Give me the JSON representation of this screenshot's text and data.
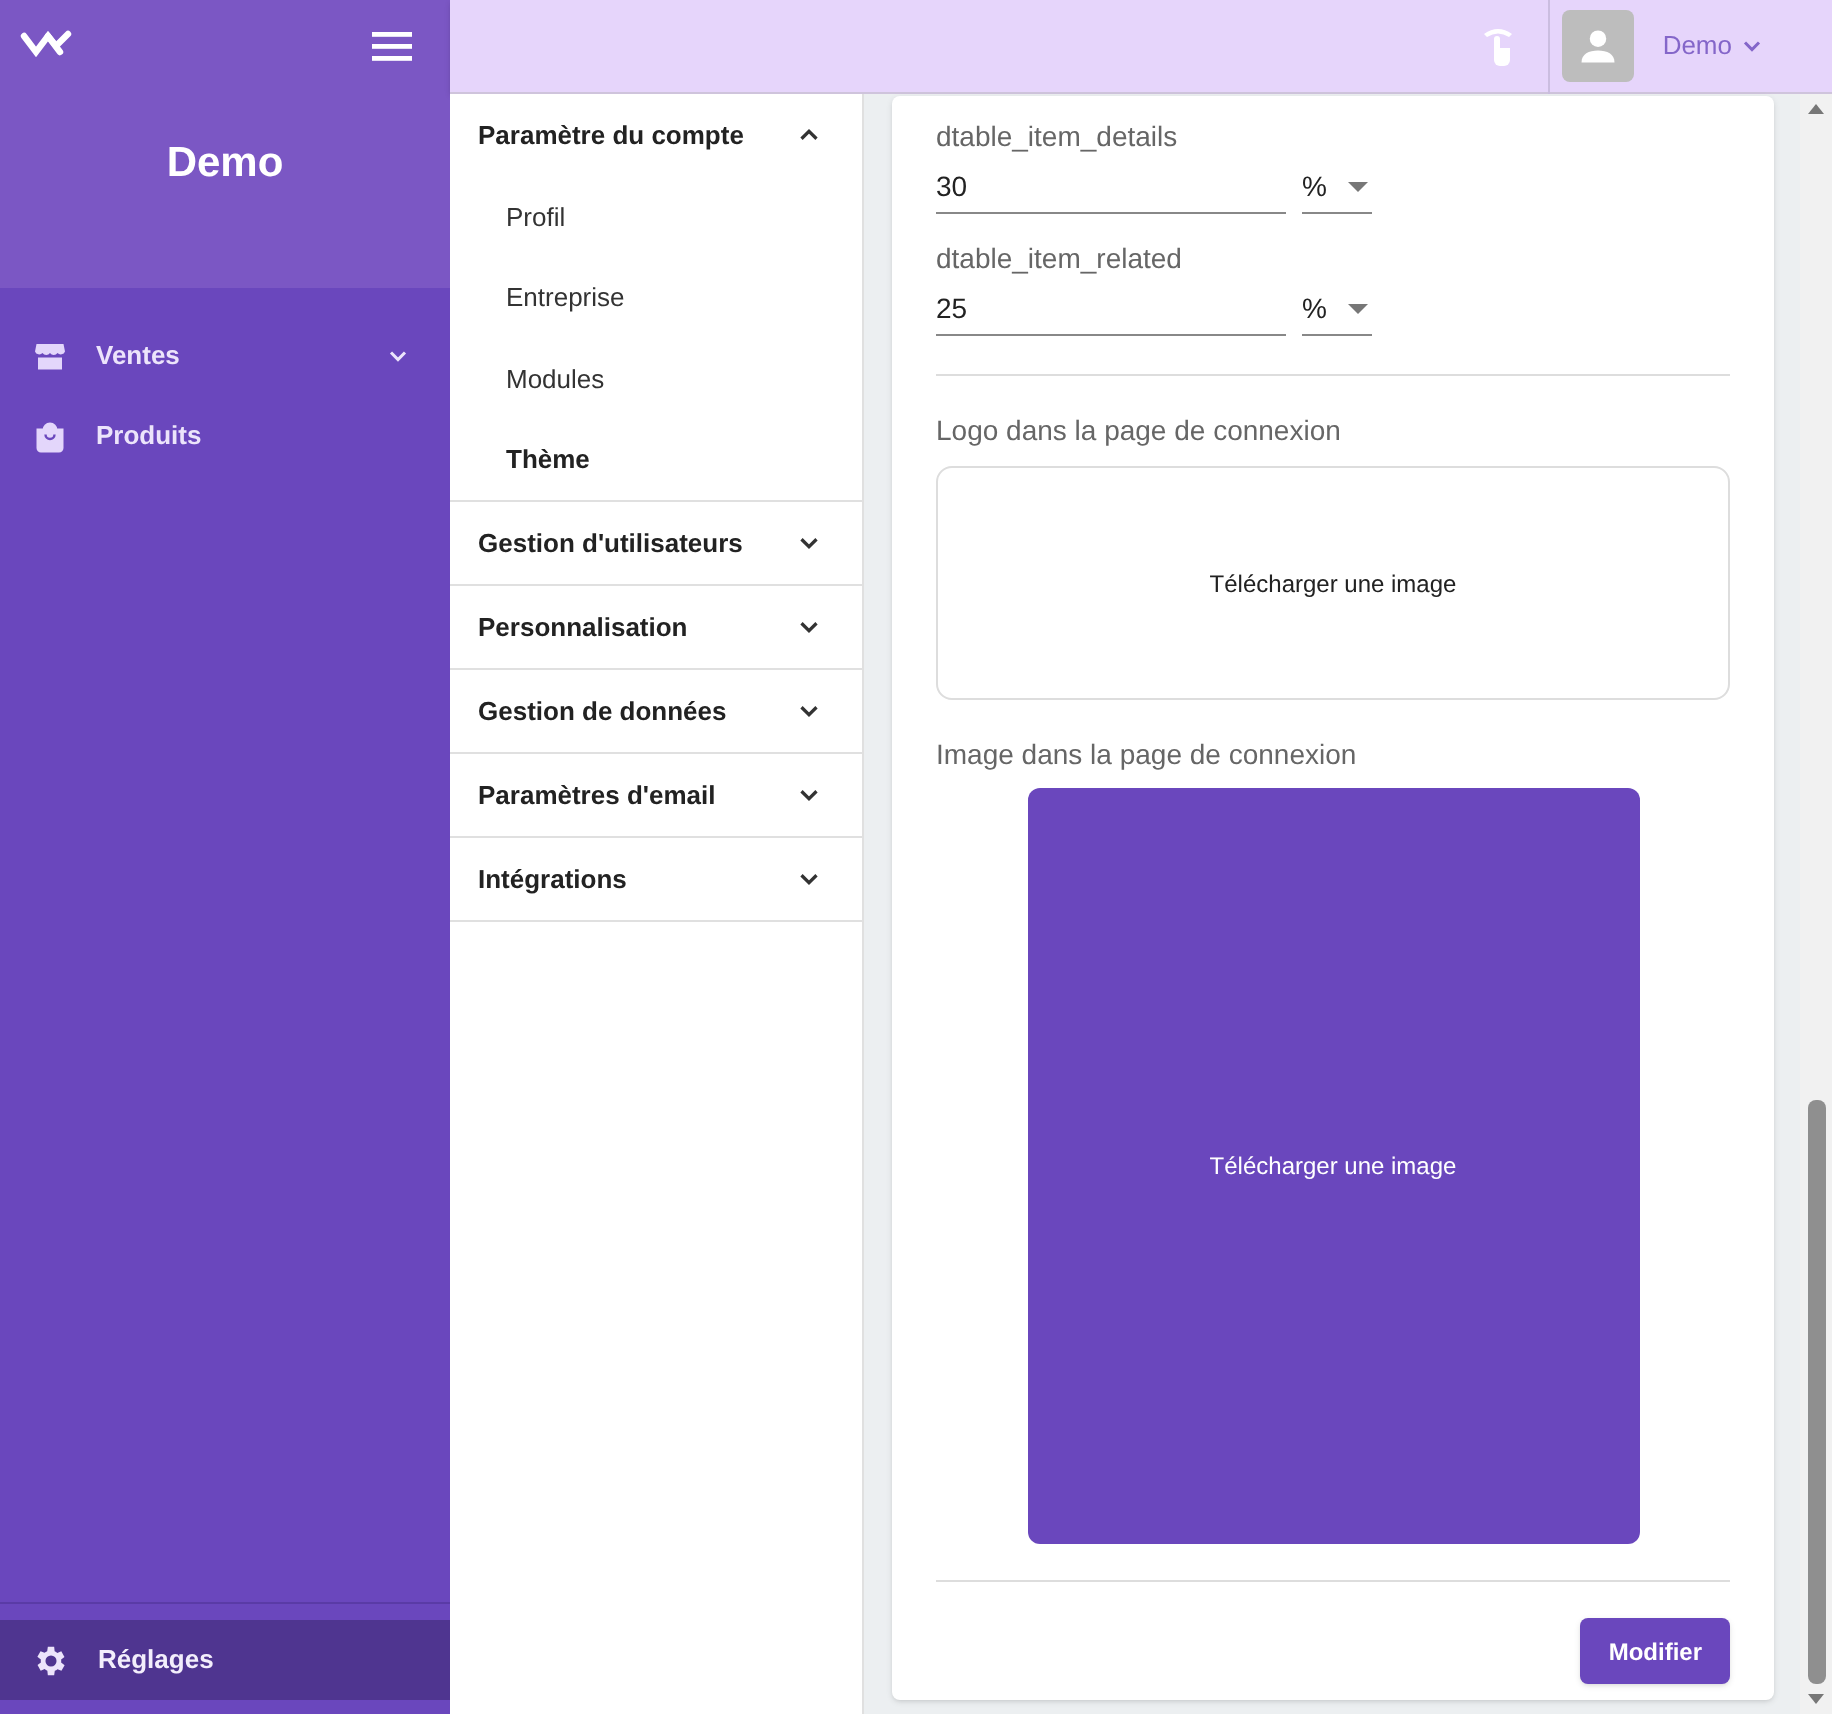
{
  "sidebar": {
    "title": "Demo",
    "nav": [
      {
        "label": "Ventes",
        "kind": "store",
        "expandable": true,
        "selected": false
      },
      {
        "label": "Produits",
        "kind": "bag",
        "expandable": false,
        "selected": false
      }
    ],
    "footer_item": {
      "label": "Réglages",
      "selected": true
    }
  },
  "topbar": {
    "user": "Demo"
  },
  "settings_menu": [
    {
      "label": "Paramètre du compte",
      "expanded": true,
      "children": [
        {
          "label": "Profil",
          "selected": false
        },
        {
          "label": "Entreprise",
          "selected": false
        },
        {
          "label": "Modules",
          "selected": false
        },
        {
          "label": "Thème",
          "selected": true
        }
      ]
    },
    {
      "label": "Gestion d'utilisateurs",
      "expanded": false
    },
    {
      "label": "Personnalisation",
      "expanded": false
    },
    {
      "label": "Gestion de données",
      "expanded": false
    },
    {
      "label": "Paramètres d'email",
      "expanded": false
    },
    {
      "label": "Intégrations",
      "expanded": false
    }
  ],
  "fields": [
    {
      "label": "dtable_item_details",
      "value": "30",
      "unit": "%"
    },
    {
      "label": "dtable_item_related",
      "value": "25",
      "unit": "%"
    }
  ],
  "uploads": [
    {
      "label": "Logo dans la page de connexion",
      "button": "Télécharger une image",
      "kind": "logo"
    },
    {
      "label": "Image dans la page de connexion",
      "button": "Télécharger une image",
      "kind": "image"
    }
  ],
  "submit": "Modifier"
}
